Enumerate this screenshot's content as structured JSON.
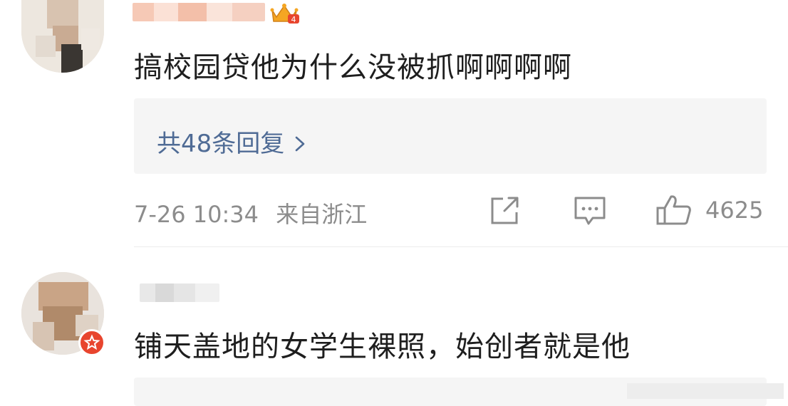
{
  "comments": [
    {
      "text": "搞校园贷他为什么没被抓啊啊啊啊",
      "reply_link": "共48条回复",
      "time": "7-26 10:34",
      "location": "来自浙江",
      "like_count": "4625",
      "icons": {
        "share": "share-icon",
        "comment": "comment-icon",
        "like": "like-icon"
      }
    },
    {
      "text": "铺天盖地的女学生裸照，始创者就是他"
    }
  ],
  "colors": {
    "reply_link": "#4f6b95",
    "meta_text": "#8c8c8c",
    "body_text": "#1e1e1e",
    "reply_bg": "#f5f5f5",
    "verify_badge": "#e8452e"
  }
}
